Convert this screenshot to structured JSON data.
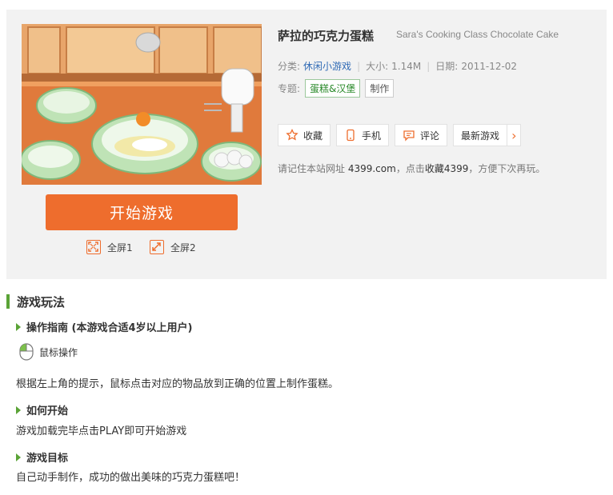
{
  "game": {
    "title": "萨拉的巧克力蛋糕",
    "english_title": "Sara's Cooking Class Chocolate Cake",
    "start_label": "开始游戏",
    "fullscreen1_label": "全屏1",
    "fullscreen2_label": "全屏2"
  },
  "meta": {
    "category_label": "分类:",
    "category_value": "休闲小游戏",
    "size_label": "大小:",
    "size_value": "1.14M",
    "date_label": "日期:",
    "date_value": "2011-12-02"
  },
  "topics": {
    "label": "专题:",
    "items": [
      "蛋糕&汉堡",
      "制作"
    ]
  },
  "actions": {
    "favorite": "收藏",
    "mobile": "手机",
    "comment": "评论",
    "latest": "最新游戏",
    "more_arrow": "›"
  },
  "tip": {
    "prefix": "请记住本站网址 ",
    "site": "4399.com",
    "middle": "，点击",
    "bookmark": "收藏4399",
    "suffix": "，方便下次再玩。"
  },
  "guide": {
    "section_title": "游戏玩法",
    "controls_title": "操作指南 (本游戏合适4岁以上用户)",
    "mouse_label": "鼠标操作",
    "controls_text": "根据左上角的提示，鼠标点击对应的物品放到正确的位置上制作蛋糕。",
    "howto_title": "如何开始",
    "howto_text": "游戏加载完毕点击PLAY即可开始游戏",
    "goal_title": "游戏目标",
    "goal_text": "自己动手制作，成功的做出美味的巧克力蛋糕吧！"
  },
  "colors": {
    "accent_orange": "#ee6d2d",
    "accent_green": "#5aa336",
    "link_blue": "#2f6ab5",
    "panel_bg": "#f2f2f2"
  }
}
